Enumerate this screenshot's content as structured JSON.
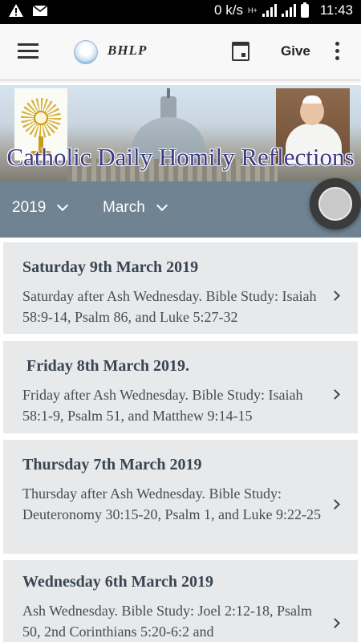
{
  "status_bar": {
    "speed": "0 k/s",
    "network_type": "H+",
    "time": "11:43",
    "icons": [
      "warning-icon",
      "mail-icon",
      "signal-icon",
      "battery-icon"
    ]
  },
  "app_bar": {
    "brand": "BHLP",
    "give_label": "Give",
    "icons": [
      "menu-icon",
      "logo-icon",
      "calendar-icon",
      "more-vert-icon"
    ]
  },
  "banner": {
    "title": "Catholic Daily Homily Reflections"
  },
  "filters": {
    "year": "2019",
    "month": "March"
  },
  "entries": [
    {
      "title": "Saturday 9th March 2019",
      "description": "Saturday after Ash Wednesday. Bible Study: Isaiah 58:9-14, Psalm 86, and Luke 5:27-32"
    },
    {
      "title": " Friday 8th March 2019.",
      "description": "Friday after Ash Wednesday. Bible Study: Isaiah 58:1-9, Psalm 51, and Matthew 9:14-15"
    },
    {
      "title": "Thursday 7th March 2019",
      "description": "Thursday after Ash Wednesday. Bible Study: Deuteronomy 30:15-20, Psalm 1, and Luke 9:22-25"
    },
    {
      "title": "Wednesday 6th March 2019",
      "description": "Ash Wednesday. Bible Study: Joel 2:12-18, Psalm 50, 2nd Corinthians 5:20-6:2 and"
    }
  ],
  "colors": {
    "filter_bar": "#6f8393",
    "card_bg": "#e7e9ea",
    "banner_title": "#3e3a86"
  }
}
